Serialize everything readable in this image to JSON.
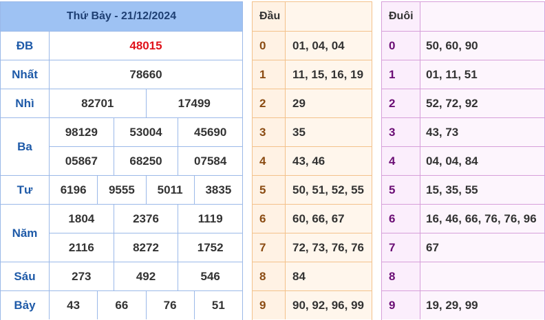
{
  "results": {
    "title": "Thứ Bảy - 21/12/2024",
    "prizes": [
      {
        "label": "ĐB",
        "lines": [
          [
            "48015"
          ]
        ]
      },
      {
        "label": "Nhất",
        "lines": [
          [
            "78660"
          ]
        ]
      },
      {
        "label": "Nhì",
        "lines": [
          [
            "82701",
            "17499"
          ]
        ]
      },
      {
        "label": "Ba",
        "lines": [
          [
            "98129",
            "53004",
            "45690"
          ],
          [
            "05867",
            "68250",
            "07584"
          ]
        ]
      },
      {
        "label": "Tư",
        "lines": [
          [
            "6196",
            "9555",
            "5011",
            "3835"
          ]
        ]
      },
      {
        "label": "Năm",
        "lines": [
          [
            "1804",
            "2376",
            "1119"
          ],
          [
            "2116",
            "8272",
            "1752"
          ]
        ]
      },
      {
        "label": "Sáu",
        "lines": [
          [
            "273",
            "492",
            "546"
          ]
        ]
      },
      {
        "label": "Bảy",
        "lines": [
          [
            "43",
            "66",
            "76",
            "51"
          ]
        ]
      }
    ]
  },
  "dau": {
    "title": "Đầu",
    "rows": [
      {
        "k": "0",
        "v": "01, 04, 04"
      },
      {
        "k": "1",
        "v": "11, 15, 16, 19"
      },
      {
        "k": "2",
        "v": "29"
      },
      {
        "k": "3",
        "v": "35"
      },
      {
        "k": "4",
        "v": "43, 46"
      },
      {
        "k": "5",
        "v": "50, 51, 52, 55"
      },
      {
        "k": "6",
        "v": "60, 66, 67"
      },
      {
        "k": "7",
        "v": "72, 73, 76, 76"
      },
      {
        "k": "8",
        "v": "84"
      },
      {
        "k": "9",
        "v": "90, 92, 96, 99"
      }
    ]
  },
  "duoi": {
    "title": "Đuôi",
    "rows": [
      {
        "k": "0",
        "v": "50, 60, 90"
      },
      {
        "k": "1",
        "v": "01, 11, 51"
      },
      {
        "k": "2",
        "v": "52, 72, 92"
      },
      {
        "k": "3",
        "v": "43, 73"
      },
      {
        "k": "4",
        "v": "04, 04, 84"
      },
      {
        "k": "5",
        "v": "15, 35, 55"
      },
      {
        "k": "6",
        "v": "16, 46, 66, 76, 76, 96"
      },
      {
        "k": "7",
        "v": "67"
      },
      {
        "k": "8",
        "v": ""
      },
      {
        "k": "9",
        "v": "19, 29, 99"
      }
    ]
  },
  "colors": {
    "special_prize": "#e0121a",
    "results_header": "#9ec2f3",
    "dau_header": "#f9cd9d",
    "duoi_header": "#e8b4ec"
  }
}
